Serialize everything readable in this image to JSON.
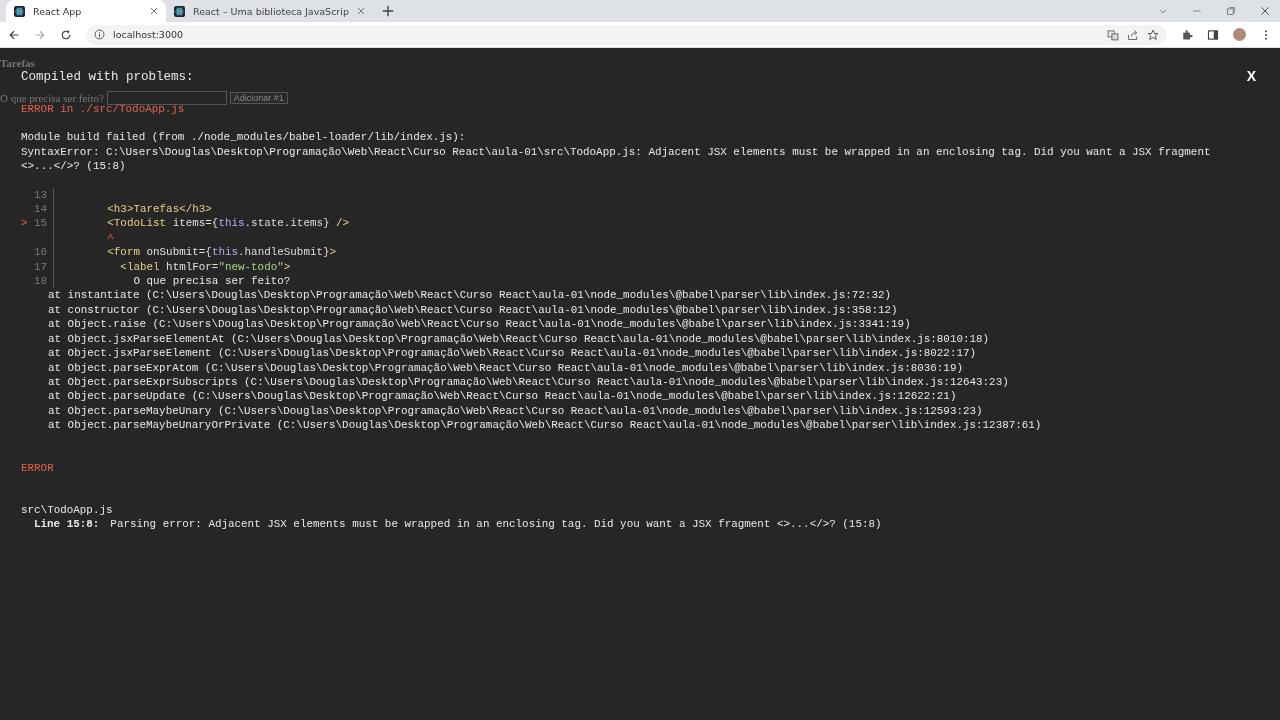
{
  "browser": {
    "tabs": [
      {
        "title": "React App",
        "selected": true
      },
      {
        "title": "React – Uma biblioteca JavaScrip",
        "selected": false
      }
    ],
    "address": "localhost:3000"
  },
  "page": {
    "heading": "Tarefas",
    "label": "O que precisa ser feito?",
    "button": "Adicionar #1"
  },
  "overlay": {
    "title": "Compiled with problems:",
    "close": "X",
    "errors": [
      {
        "kind": "build",
        "heading": "ERROR in ./src/TodoApp.js",
        "message_lines": [
          "Module build failed (from ./node_modules/babel-loader/lib/index.js):",
          "SyntaxError: C:\\Users\\Douglas\\Desktop\\Programação\\Web\\React\\Curso React\\aula-01\\src\\TodoApp.js: Adjacent JSX elements must be wrapped in an enclosing tag. Did you want a JSX fragment",
          "<>...</>? (15:8)"
        ],
        "code_frame": [
          {
            "number": "13"
          },
          {
            "number": "14",
            "segments": [
              {
                "kind": "tag",
                "text": "        <h3>Tarefas</h3>"
              }
            ]
          },
          {
            "number": "15",
            "marker": ">",
            "segments": [
              {
                "kind": "tag",
                "text": "        <TodoList "
              },
              {
                "kind": "attr",
                "text": "items="
              },
              {
                "kind": "punct",
                "text": "{"
              },
              {
                "kind": "keyword",
                "text": "this"
              },
              {
                "kind": "punct",
                "text": ".state.items} "
              },
              {
                "kind": "tag",
                "text": "/>"
              }
            ]
          },
          {
            "segments": [
              {
                "kind": "caret",
                "text": "        ^"
              }
            ]
          },
          {
            "number": "16",
            "segments": [
              {
                "kind": "tag",
                "text": "        <form "
              },
              {
                "kind": "attr",
                "text": "onSubmit="
              },
              {
                "kind": "punct",
                "text": "{"
              },
              {
                "kind": "keyword",
                "text": "this"
              },
              {
                "kind": "punct",
                "text": ".handleSubmit}"
              },
              {
                "kind": "tag",
                "text": ">"
              }
            ]
          },
          {
            "number": "17",
            "segments": [
              {
                "kind": "tag",
                "text": "          <label "
              },
              {
                "kind": "attr",
                "text": "htmlFor="
              },
              {
                "kind": "string",
                "text": "\"new-todo\""
              },
              {
                "kind": "tag",
                "text": ">"
              }
            ]
          },
          {
            "number": "18",
            "segments": [
              {
                "kind": "text",
                "text": "            O que precisa ser feito?"
              }
            ]
          }
        ],
        "stack": [
          "at instantiate (C:\\Users\\Douglas\\Desktop\\Programação\\Web\\React\\Curso React\\aula-01\\node_modules\\@babel\\parser\\lib\\index.js:72:32)",
          "at constructor (C:\\Users\\Douglas\\Desktop\\Programação\\Web\\React\\Curso React\\aula-01\\node_modules\\@babel\\parser\\lib\\index.js:358:12)",
          "at Object.raise (C:\\Users\\Douglas\\Desktop\\Programação\\Web\\React\\Curso React\\aula-01\\node_modules\\@babel\\parser\\lib\\index.js:3341:19)",
          "at Object.jsxParseElementAt (C:\\Users\\Douglas\\Desktop\\Programação\\Web\\React\\Curso React\\aula-01\\node_modules\\@babel\\parser\\lib\\index.js:8010:18)",
          "at Object.jsxParseElement (C:\\Users\\Douglas\\Desktop\\Programação\\Web\\React\\Curso React\\aula-01\\node_modules\\@babel\\parser\\lib\\index.js:8022:17)",
          "at Object.parseExprAtom (C:\\Users\\Douglas\\Desktop\\Programação\\Web\\React\\Curso React\\aula-01\\node_modules\\@babel\\parser\\lib\\index.js:8036:19)",
          "at Object.parseExprSubscripts (C:\\Users\\Douglas\\Desktop\\Programação\\Web\\React\\Curso React\\aula-01\\node_modules\\@babel\\parser\\lib\\index.js:12643:23)",
          "at Object.parseUpdate (C:\\Users\\Douglas\\Desktop\\Programação\\Web\\React\\Curso React\\aula-01\\node_modules\\@babel\\parser\\lib\\index.js:12622:21)",
          "at Object.parseMaybeUnary (C:\\Users\\Douglas\\Desktop\\Programação\\Web\\React\\Curso React\\aula-01\\node_modules\\@babel\\parser\\lib\\index.js:12593:23)",
          "at Object.parseMaybeUnaryOrPrivate (C:\\Users\\Douglas\\Desktop\\Programação\\Web\\React\\Curso React\\aula-01\\node_modules\\@babel\\parser\\lib\\index.js:12387:61)"
        ]
      },
      {
        "kind": "lint",
        "heading": "ERROR",
        "file": "src\\TodoApp.js",
        "location": "Line 15:8:",
        "message": "Parsing error: Adjacent JSX elements must be wrapped in an enclosing tag. Did you want a JSX fragment <>...</>? (15:8)"
      }
    ]
  }
}
